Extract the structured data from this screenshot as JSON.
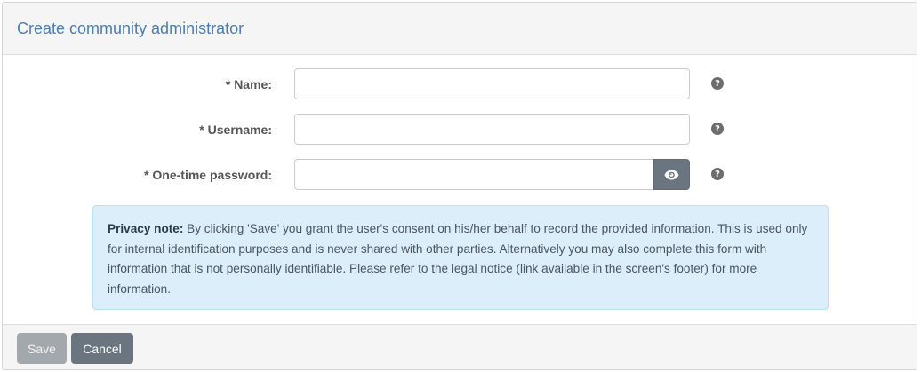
{
  "header": {
    "title": "Create community administrator"
  },
  "form": {
    "fields": [
      {
        "label": "* Name:",
        "value": "",
        "help": "?"
      },
      {
        "label": "* Username:",
        "value": "",
        "help": "?"
      },
      {
        "label": "* One-time password:",
        "value": "",
        "help": "?",
        "reveal_icon": "eye-icon"
      }
    ]
  },
  "privacy": {
    "title": "Privacy note:",
    "text": "By clicking 'Save' you grant the user's consent on his/her behalf to record the provided information. This is used only for internal identification purposes and is never shared with other parties. Alternatively you may also complete this form with information that is not personally identifiable. Please refer to the legal notice (link available in the screen's footer) for more information."
  },
  "footer": {
    "save_label": "Save",
    "cancel_label": "Cancel"
  },
  "colors": {
    "title": "#4a7db5",
    "privacy_bg": "#dbeef9",
    "button_dark": "#6b7580",
    "button_disabled": "#a3a8ad"
  }
}
